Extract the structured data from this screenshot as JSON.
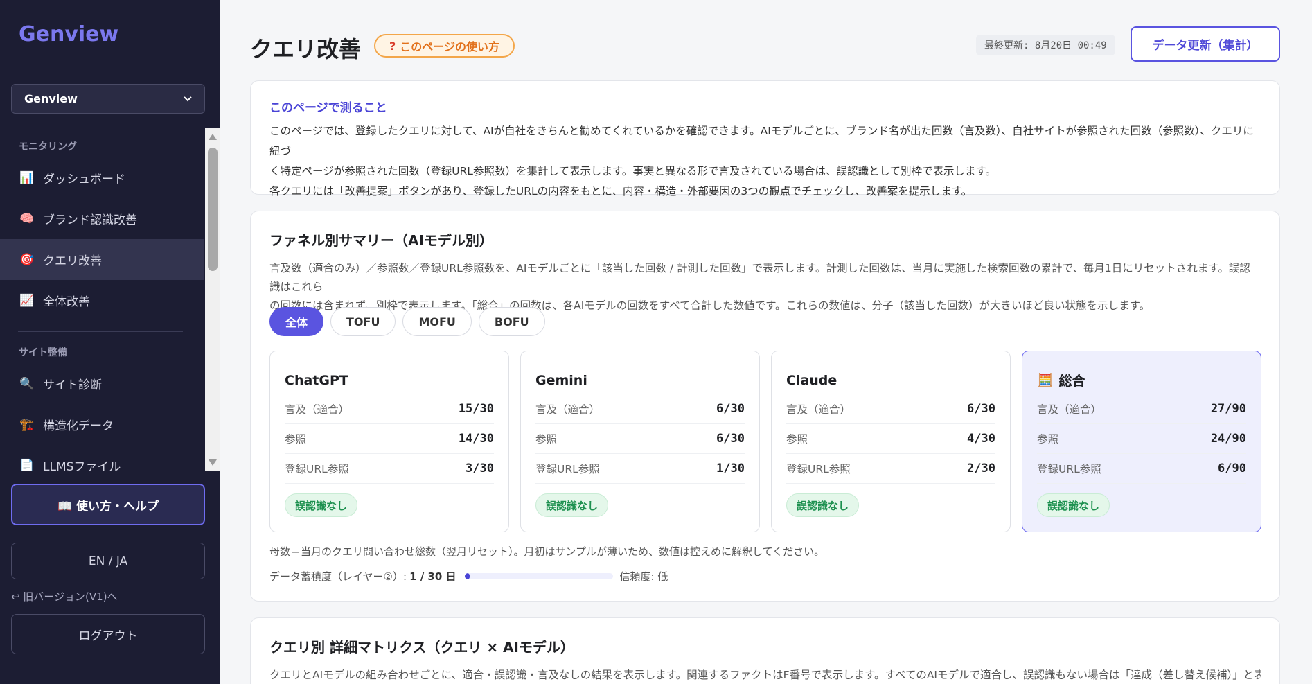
{
  "sidebar": {
    "brand": "Genview",
    "workspace": "Genview",
    "sections": [
      {
        "title": "モニタリング"
      },
      {
        "title": "サイト整備"
      }
    ],
    "items": [
      {
        "label": "ダッシュボード",
        "icon": "📊"
      },
      {
        "label": "ブランド認識改善",
        "icon": "🧠"
      },
      {
        "label": "クエリ改善",
        "icon": "🎯"
      },
      {
        "label": "全体改善",
        "icon": "📈"
      },
      {
        "label": "サイト診断",
        "icon": "🔍"
      },
      {
        "label": "構造化データ",
        "icon": "🏗️"
      },
      {
        "label": "LLMSファイル",
        "icon": "📄"
      }
    ],
    "help_label": "📖 使い方・ヘルプ",
    "lang_label": "EN / JA",
    "old_version_label": "↩ 旧バージョン(V1)へ",
    "logout_label": "ログアウト"
  },
  "header": {
    "title": "クエリ改善",
    "help_pill": "このページの使い方",
    "help_pill_icon": "?",
    "last_updated": "最終更新: 8月20日 00:49",
    "refresh_label": "データ更新（集計）"
  },
  "about": {
    "title": "このページで測ること",
    "lines": [
      "このページでは、登録したクエリに対して、AIが自社をきちんと勧めてくれているかを確認できます。AIモデルごとに、ブランド名が出た回数（言及数）、自社サイトが参照された回数（参照数）、クエリに紐づ",
      "く特定ページが参照された回数（登録URL参照数）を集計して表示します。事実と異なる形で言及されている場合は、誤認識として別枠で表示します。",
      "各クエリには「改善提案」ボタンがあり、登録したURLの内容をもとに、内容・構造・外部要因の3つの観点でチェックし、改善案を提示します。"
    ]
  },
  "funnel": {
    "title": "ファネル別サマリー（AIモデル別）",
    "desc_lines": [
      "言及数（適合のみ）／参照数／登録URL参照数を、AIモデルごとに「該当した回数 / 計測した回数」で表示します。計測した回数は、当月に実施した検索回数の累計で、毎月1日にリセットされます。誤認識はこれら",
      "の回数には含まれず、別枠で表示します。「総合」の回数は、各AIモデルの回数をすべて合計した数値です。これらの数値は、分子（該当した回数）が大きいほど良い状態を示します。"
    ],
    "tabs": [
      "全体",
      "TOFU",
      "MOFU",
      "BOFU"
    ],
    "active_tab": 0,
    "metric_labels": [
      "言及（適合）",
      "参照",
      "登録URL参照"
    ],
    "models": [
      {
        "name": "ChatGPT",
        "icon": "",
        "values": [
          "15/30",
          "14/30",
          "3/30"
        ],
        "badge": "誤認識なし"
      },
      {
        "name": "Gemini",
        "icon": "",
        "values": [
          "6/30",
          "6/30",
          "1/30"
        ],
        "badge": "誤認識なし"
      },
      {
        "name": "Claude",
        "icon": "",
        "values": [
          "6/30",
          "4/30",
          "2/30"
        ],
        "badge": "誤認識なし"
      },
      {
        "name": "総合",
        "icon": "🧮",
        "values": [
          "27/90",
          "24/90",
          "6/90"
        ],
        "badge": "誤認識なし"
      }
    ],
    "footnote": "母数＝当月のクエリ問い合わせ総数（翌月リセット）。月初はサンプルが薄いため、数値は控えめに解釈してください。",
    "accum_label": "データ蓄積度（レイヤー②）:",
    "accum_value": "1 / 30 日",
    "accum_fraction": 0.033,
    "reliability": "信頼度: 低"
  },
  "matrix": {
    "title": "クエリ別 詳細マトリクス（クエリ × AIモデル）",
    "desc": "クエリとAIモデルの組み合わせごとに、適合・誤認識・言及なしの結果を表示します。関連するファクトはF番号で表示します。すべてのAIモデルで適合し、誤認識もない場合は「達成（差し替え候補）」と表示されま"
  }
}
